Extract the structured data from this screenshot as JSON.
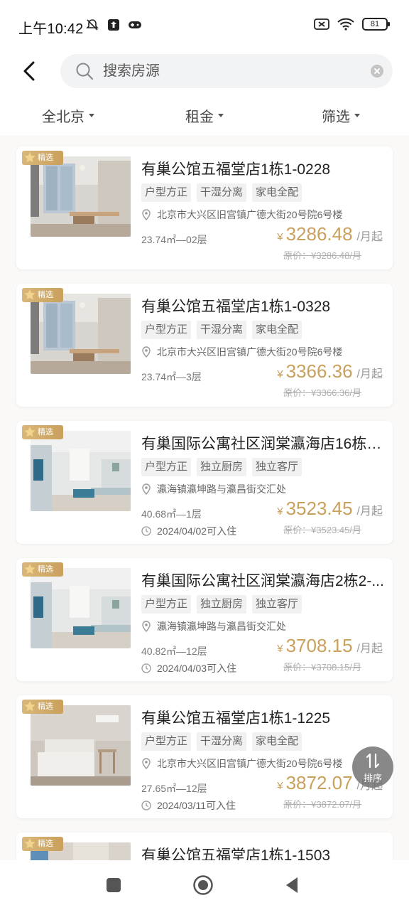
{
  "status": {
    "time": "上午10:42",
    "battery": "81"
  },
  "search": {
    "placeholder": "搜索房源"
  },
  "filters": [
    {
      "label": "全北京"
    },
    {
      "label": "租金"
    },
    {
      "label": "筛选"
    }
  ],
  "badge_label": "精选",
  "listings": [
    {
      "title": "有巢公馆五福堂店1栋1-0228",
      "tags": [
        "户型方正",
        "干湿分离",
        "家电全配"
      ],
      "address": "北京市大兴区旧宫镇广德大街20号院6号楼",
      "area_floor": "23.74㎡—02层",
      "available": "",
      "currency": "¥",
      "price": "3286.48",
      "unit": "/月起",
      "original": "原价：¥3286.48/月"
    },
    {
      "title": "有巢公馆五福堂店1栋1-0328",
      "tags": [
        "户型方正",
        "干湿分离",
        "家电全配"
      ],
      "address": "北京市大兴区旧宫镇广德大街20号院6号楼",
      "area_floor": "23.74㎡—3层",
      "available": "",
      "currency": "¥",
      "price": "3366.36",
      "unit": "/月起",
      "original": "原价：¥3366.36/月"
    },
    {
      "title": "有巢国际公寓社区润棠瀛海店16栋1...",
      "tags": [
        "户型方正",
        "独立厨房",
        "独立客厅"
      ],
      "address": "瀛海镇瀛坤路与瀛昌街交汇处",
      "area_floor": "40.68㎡—1层",
      "available": "2024/04/02可入住",
      "currency": "¥",
      "price": "3523.45",
      "unit": "/月起",
      "original": "原价：¥3523.45/月"
    },
    {
      "title": "有巢国际公寓社区润棠瀛海店2栋2-...",
      "tags": [
        "户型方正",
        "独立厨房",
        "独立客厅"
      ],
      "address": "瀛海镇瀛坤路与瀛昌街交汇处",
      "area_floor": "40.82㎡—12层",
      "available": "2024/04/03可入住",
      "currency": "¥",
      "price": "3708.15",
      "unit": "/月起",
      "original": "原价：¥3708.15/月"
    },
    {
      "title": "有巢公馆五福堂店1栋1-1225",
      "tags": [
        "户型方正",
        "干湿分离",
        "家电全配"
      ],
      "address": "北京市大兴区旧宫镇广德大街20号院6号楼",
      "area_floor": "27.65㎡—12层",
      "available": "2024/03/11可入住",
      "currency": "¥",
      "price": "3872.07",
      "unit": "/月起",
      "original": "原价：¥3872.07/月"
    },
    {
      "title": "有巢公馆五福堂店1栋1-1503",
      "tags": [],
      "address": "",
      "area_floor": "",
      "available": "",
      "currency": "",
      "price": "",
      "unit": "",
      "original": ""
    }
  ],
  "sort_label": "排序",
  "colors": {
    "accent": "#c9a05c",
    "badge": "#d4b06f",
    "page_bg": "#faf9f7"
  }
}
